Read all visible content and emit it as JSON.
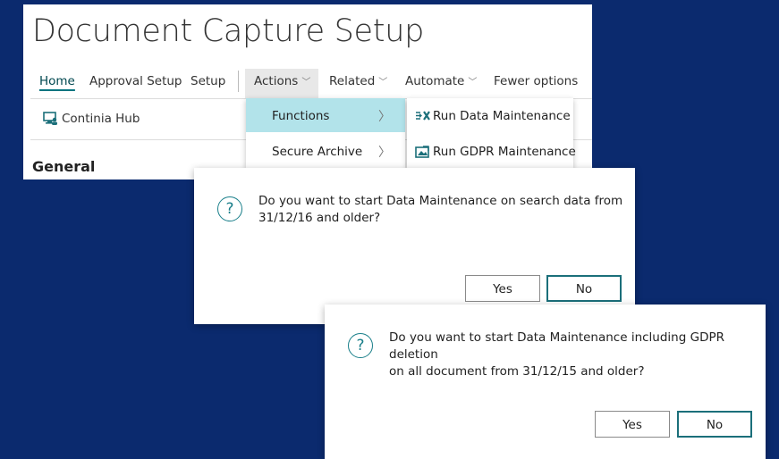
{
  "page": {
    "title": "Document Capture Setup"
  },
  "nav": {
    "home": "Home",
    "approval_setup": "Approval Setup",
    "setup": "Setup",
    "actions": "Actions",
    "related": "Related",
    "automate": "Automate",
    "fewer_options": "Fewer options"
  },
  "toolbar": {
    "continia_hub": "Continia Hub"
  },
  "section": {
    "general": "General"
  },
  "menu_actions": [
    {
      "label": "Functions"
    },
    {
      "label": "Secure Archive"
    }
  ],
  "menu_functions": [
    {
      "label": "Run Data Maintenance"
    },
    {
      "label": "Run GDPR Maintenance"
    }
  ],
  "dialog1": {
    "message_line1": "Do you want to start Data Maintenance on search data from",
    "message_line2": "31/12/16 and older?",
    "yes": "Yes",
    "no": "No"
  },
  "dialog2": {
    "message_line1": "Do you want to start Data Maintenance including GDPR deletion",
    "message_line2": "on all document from 31/12/15 and older?",
    "yes": "Yes",
    "no": "No"
  },
  "colors": {
    "background": "#0b2a6e",
    "accent": "#1b6f7a",
    "menu_highlight": "#b2e3ea"
  },
  "icons": {
    "chevron": "chevron-down-icon",
    "submenu": "chevron-right-icon",
    "question": "question-icon"
  }
}
